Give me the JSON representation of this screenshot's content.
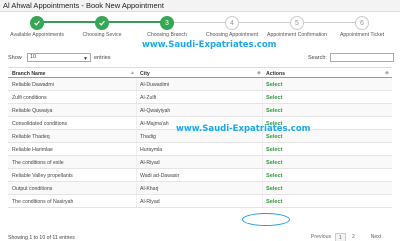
{
  "window": {
    "title": "Al Ahwal Appointments - Book New Appointment"
  },
  "wizard": {
    "steps": [
      {
        "label": "Available Appointments",
        "state": "done",
        "number": ""
      },
      {
        "label": "Choosing Sevice",
        "state": "done",
        "number": ""
      },
      {
        "label": "Choosing Branch",
        "state": "done",
        "number": "3"
      },
      {
        "label": "Choosing Appointment",
        "state": "todo",
        "number": "4"
      },
      {
        "label": "Appointment Confirmation",
        "state": "todo",
        "number": "5"
      },
      {
        "label": "Appointment Ticket",
        "state": "todo",
        "number": "6"
      }
    ]
  },
  "watermark": "www.Saudi-Expatriates.com",
  "controls": {
    "show_label": "Show",
    "entries_value": "10",
    "entries_label": "entries",
    "search_label": "Search:",
    "search_value": ""
  },
  "table": {
    "headers": {
      "branch": "Branch Name",
      "city": "City",
      "actions": "Actions"
    },
    "rows": [
      {
        "branch": "Reliable Dawadmi",
        "city": "Al-Duwadimi",
        "action": "Select"
      },
      {
        "branch": "Zulfi conditions",
        "city": "Al-Zulfi",
        "action": "Select"
      },
      {
        "branch": "Reliable Quwaiya",
        "city": "Al-Qwaiyiyah",
        "action": "Select"
      },
      {
        "branch": "Consolidated conditions",
        "city": "Al-Majma'ah",
        "action": "Select"
      },
      {
        "branch": "Reliable Thadeq",
        "city": "Thadig",
        "action": "Select"
      },
      {
        "branch": "Reliable Harimlae",
        "city": "Huraymla",
        "action": "Select"
      },
      {
        "branch": "The conditions of exile",
        "city": "Al-Riyad",
        "action": "Select"
      },
      {
        "branch": "Reliable Valley propellants",
        "city": "Wadi ad-Dawasir",
        "action": "Select"
      },
      {
        "branch": "Output conditions",
        "city": "Al-Kharj",
        "action": "Select"
      },
      {
        "branch": "The conditions of Nasiryah",
        "city": "Al-Riyad",
        "action": "Select"
      }
    ]
  },
  "footer": {
    "info": "Showing 1 to 10 of 11 entries",
    "pagination": {
      "previous": "Previous",
      "pages": [
        "1",
        "2"
      ],
      "current": "1",
      "next": "Next"
    }
  },
  "colors": {
    "step_done": "#34a853",
    "select_text": "#2e9a3c",
    "watermark": "#1aa9f0",
    "highlight": "#1a9be0"
  }
}
